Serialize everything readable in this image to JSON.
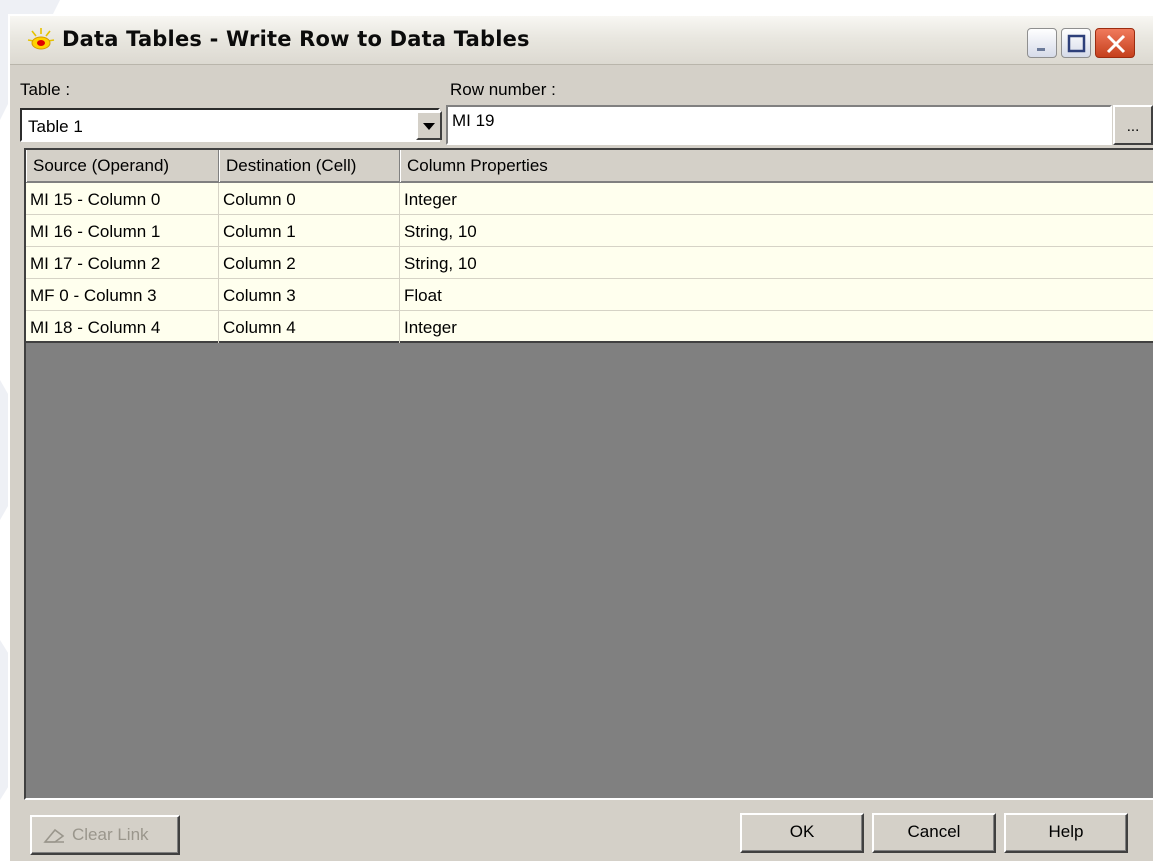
{
  "window": {
    "title": "Data Tables - Write Row to Data Tables",
    "icons": {
      "app": "sun-icon",
      "minimize": "minimize-icon",
      "maximize": "maximize-icon",
      "close": "close-icon"
    }
  },
  "form": {
    "table_label": "Table :",
    "table_value": "Table 1",
    "row_number_label": "Row number :",
    "row_number_value": "MI 19",
    "browse_label": "..."
  },
  "grid": {
    "columns": [
      "Source (Operand)",
      "Destination (Cell)",
      "Column Properties"
    ],
    "rows": [
      {
        "source": "MI 15  - Column 0",
        "destination": "Column 0",
        "properties": "Integer"
      },
      {
        "source": "MI 16  - Column 1",
        "destination": "Column 1",
        "properties": "String, 10"
      },
      {
        "source": "MI 17  - Column 2",
        "destination": "Column 2",
        "properties": "String, 10"
      },
      {
        "source": "MF 0  - Column 3",
        "destination": "Column 3",
        "properties": "Float"
      },
      {
        "source": "MI 18  - Column 4",
        "destination": "Column 4",
        "properties": "Integer"
      }
    ],
    "row_background": "#ffffee",
    "empty_background": "#808080"
  },
  "buttons": {
    "clear_link": "Clear Link",
    "clear_link_icon": "eraser-icon",
    "ok": "OK",
    "cancel": "Cancel",
    "help": "Help"
  }
}
